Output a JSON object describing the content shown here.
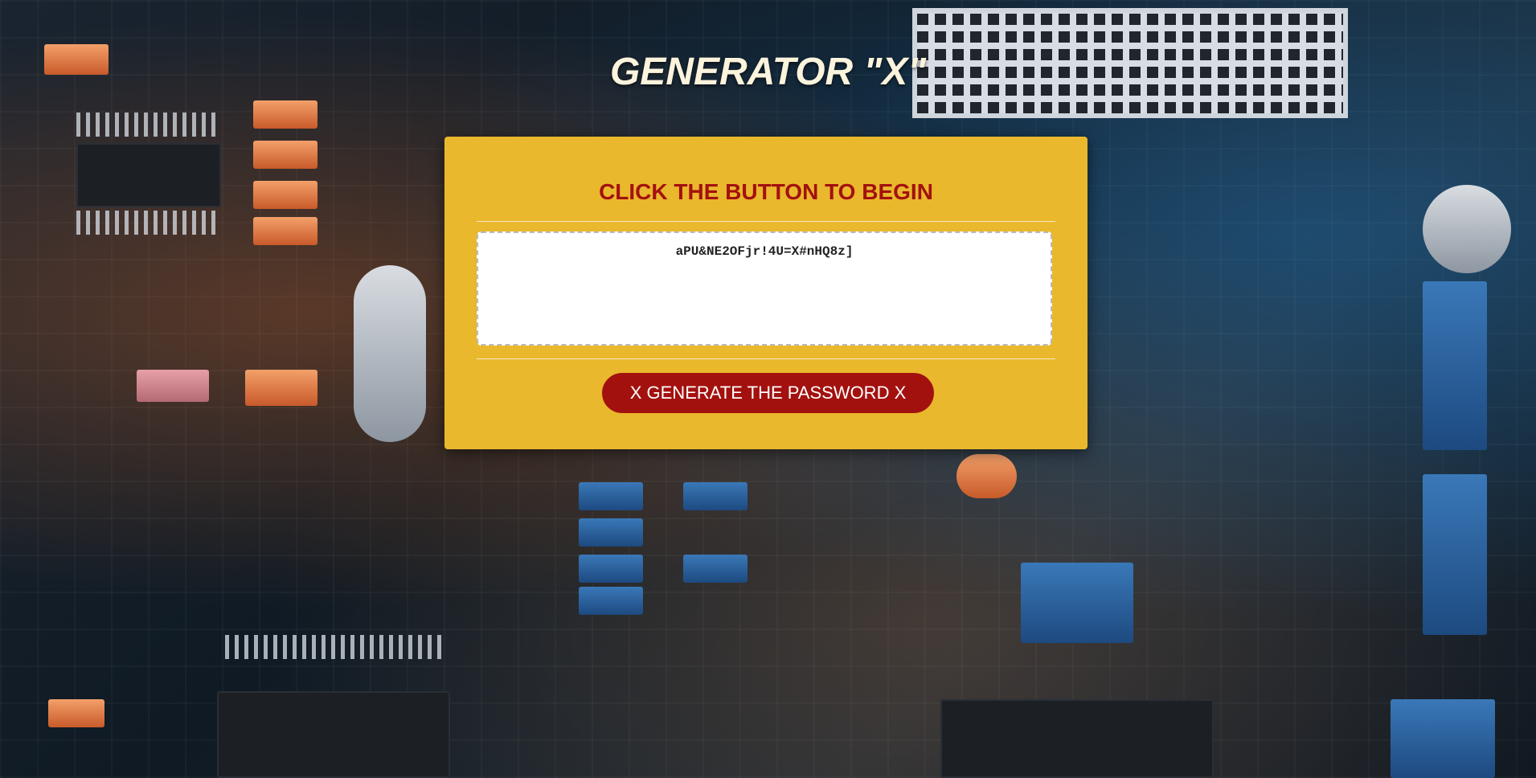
{
  "app": {
    "title": "GENERATOR \"X\""
  },
  "card": {
    "heading": "CLICK THE BUTTON TO BEGIN",
    "password_value": "aPU&NE2OFjr!4U=X#nHQ8z]",
    "generate_button_label": "X GENERATE THE PASSWORD X"
  },
  "colors": {
    "card_background": "#e9b82c",
    "accent_red": "#a3110f",
    "title_color": "#fbf3dc"
  },
  "background": {
    "description_icon": "circuit-board-image"
  }
}
